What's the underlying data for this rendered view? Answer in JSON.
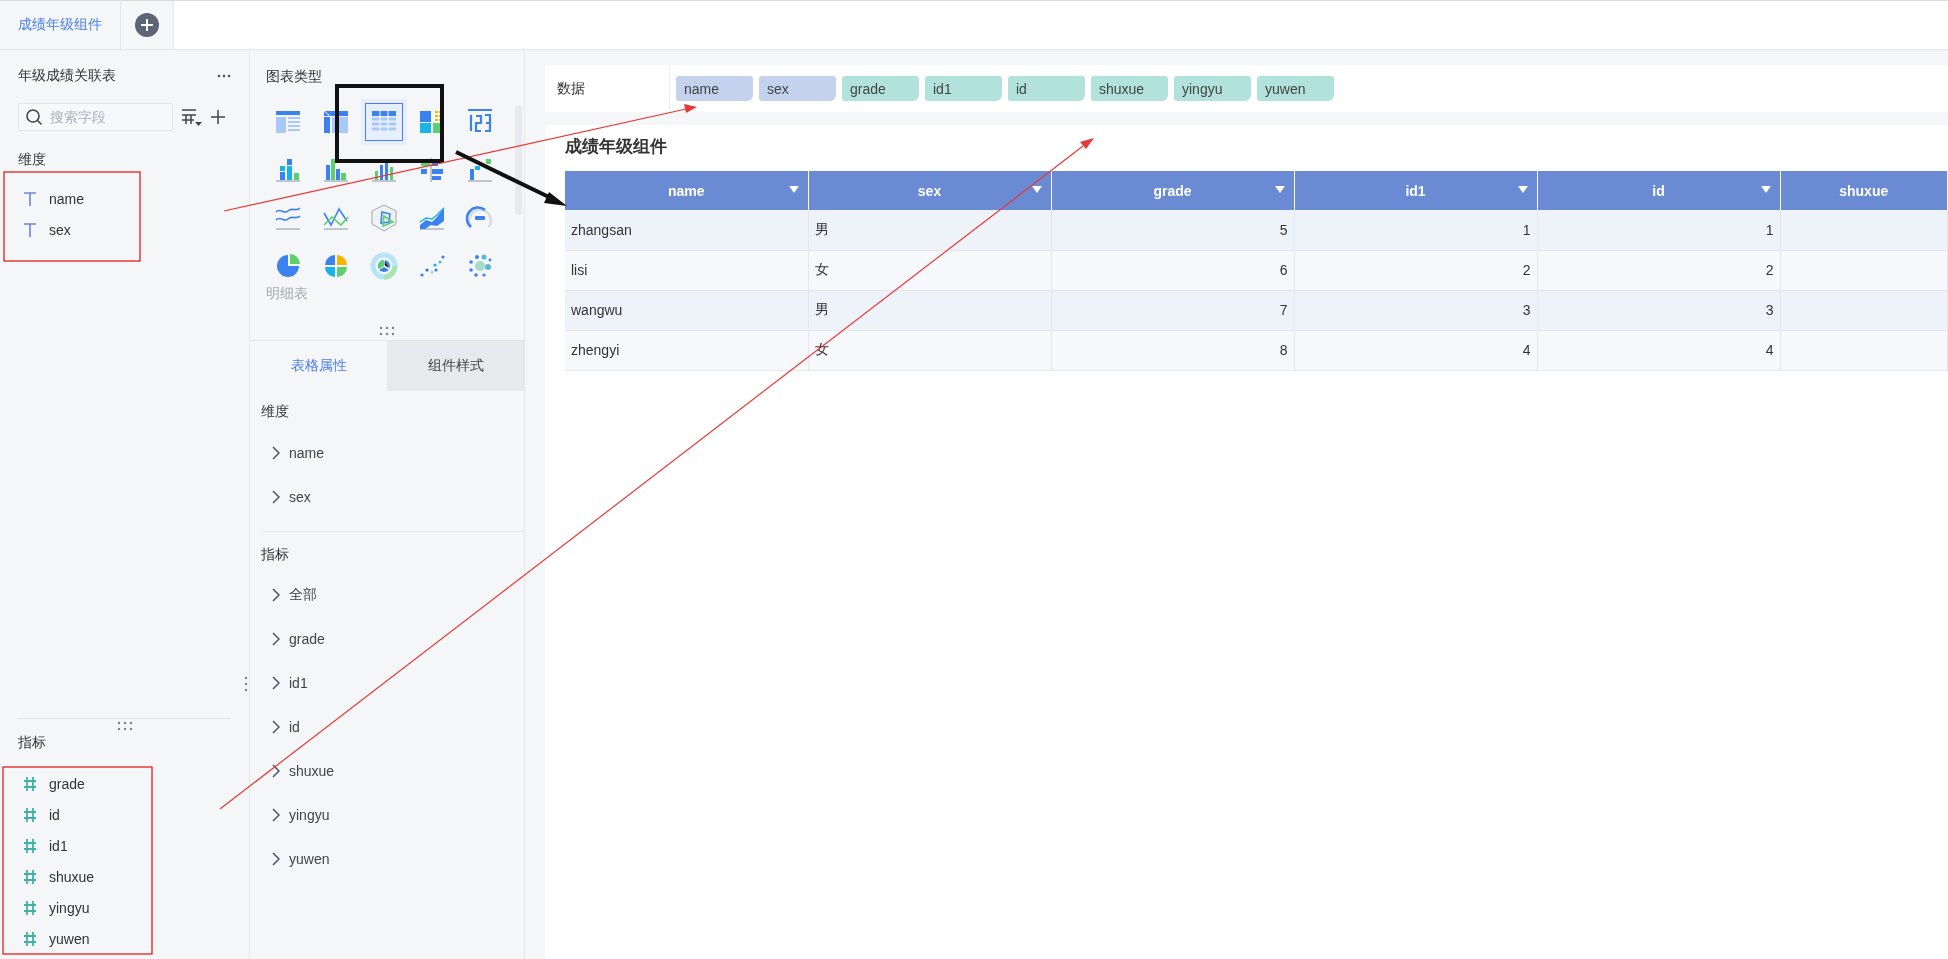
{
  "tabs": [
    {
      "label": "成绩年级组件",
      "selected": true
    }
  ],
  "fields": {
    "title": "年级成绩关联表",
    "search": {
      "placeholder": "搜索字段"
    },
    "sections": [
      {
        "title": "维度",
        "kind": "dimension",
        "items": [
          "name",
          "sex"
        ]
      },
      {
        "title": "指标",
        "kind": "measure",
        "items": [
          "grade",
          "id",
          "id1",
          "shuxue",
          "yingyu",
          "yuwen"
        ]
      }
    ]
  },
  "chart_panel": {
    "title": "图表类型",
    "types": [
      {
        "kind": "table",
        "selected": false
      },
      {
        "kind": "pivot",
        "selected": false
      },
      {
        "kind": "detail",
        "selected": true
      },
      {
        "kind": "blocks",
        "selected": false
      },
      {
        "kind": "number",
        "selected": false
      },
      {
        "kind": "stacked",
        "selected": false
      },
      {
        "kind": "grouped",
        "selected": false
      },
      {
        "kind": "bars",
        "selected": false
      },
      {
        "kind": "hbar",
        "selected": false
      },
      {
        "kind": "step",
        "selected": false
      },
      {
        "kind": "lines",
        "selected": false
      },
      {
        "kind": "polyline",
        "selected": false
      },
      {
        "kind": "radar",
        "selected": false
      },
      {
        "kind": "area",
        "selected": false
      },
      {
        "kind": "gauge",
        "selected": false
      },
      {
        "kind": "pie",
        "selected": false
      },
      {
        "kind": "multipie",
        "selected": false
      },
      {
        "kind": "ring",
        "selected": false
      },
      {
        "kind": "scatter",
        "selected": false
      },
      {
        "kind": "bubble",
        "selected": false
      }
    ],
    "caption": "明细表",
    "tabs": [
      {
        "label": "表格属性",
        "selected": true
      },
      {
        "label": "组件样式",
        "selected": false
      }
    ],
    "groups": [
      {
        "title": "维度",
        "items": [
          "name",
          "sex"
        ]
      },
      {
        "title": "指标",
        "items": [
          "全部",
          "grade",
          "id1",
          "id",
          "shuxue",
          "yingyu",
          "yuwen"
        ]
      }
    ]
  },
  "data_bar": {
    "label": "数据",
    "chips": [
      {
        "label": "name",
        "kind": "dimension"
      },
      {
        "label": "sex",
        "kind": "dimension"
      },
      {
        "label": "grade",
        "kind": "measure"
      },
      {
        "label": "id1",
        "kind": "measure"
      },
      {
        "label": "id",
        "kind": "measure"
      },
      {
        "label": "shuxue",
        "kind": "measure"
      },
      {
        "label": "yingyu",
        "kind": "measure"
      },
      {
        "label": "yuwen",
        "kind": "measure"
      }
    ]
  },
  "table": {
    "title": "成绩年级组件",
    "columns": [
      {
        "label": "name",
        "kind": "dimension",
        "menu": true
      },
      {
        "label": "sex",
        "kind": "dimension",
        "menu": true
      },
      {
        "label": "grade",
        "kind": "measure",
        "menu": true
      },
      {
        "label": "id1",
        "kind": "measure",
        "menu": true
      },
      {
        "label": "id",
        "kind": "measure",
        "menu": true
      },
      {
        "label": "shuxue",
        "kind": "measure",
        "menu": false
      }
    ],
    "rows": [
      [
        "zhangsan",
        "男",
        "5",
        "1",
        "1"
      ],
      [
        "lisi",
        "女",
        "6",
        "2",
        "2"
      ],
      [
        "wangwu",
        "男",
        "7",
        "3",
        "3"
      ],
      [
        "zhengyi",
        "女",
        "8",
        "4",
        "4"
      ]
    ]
  }
}
